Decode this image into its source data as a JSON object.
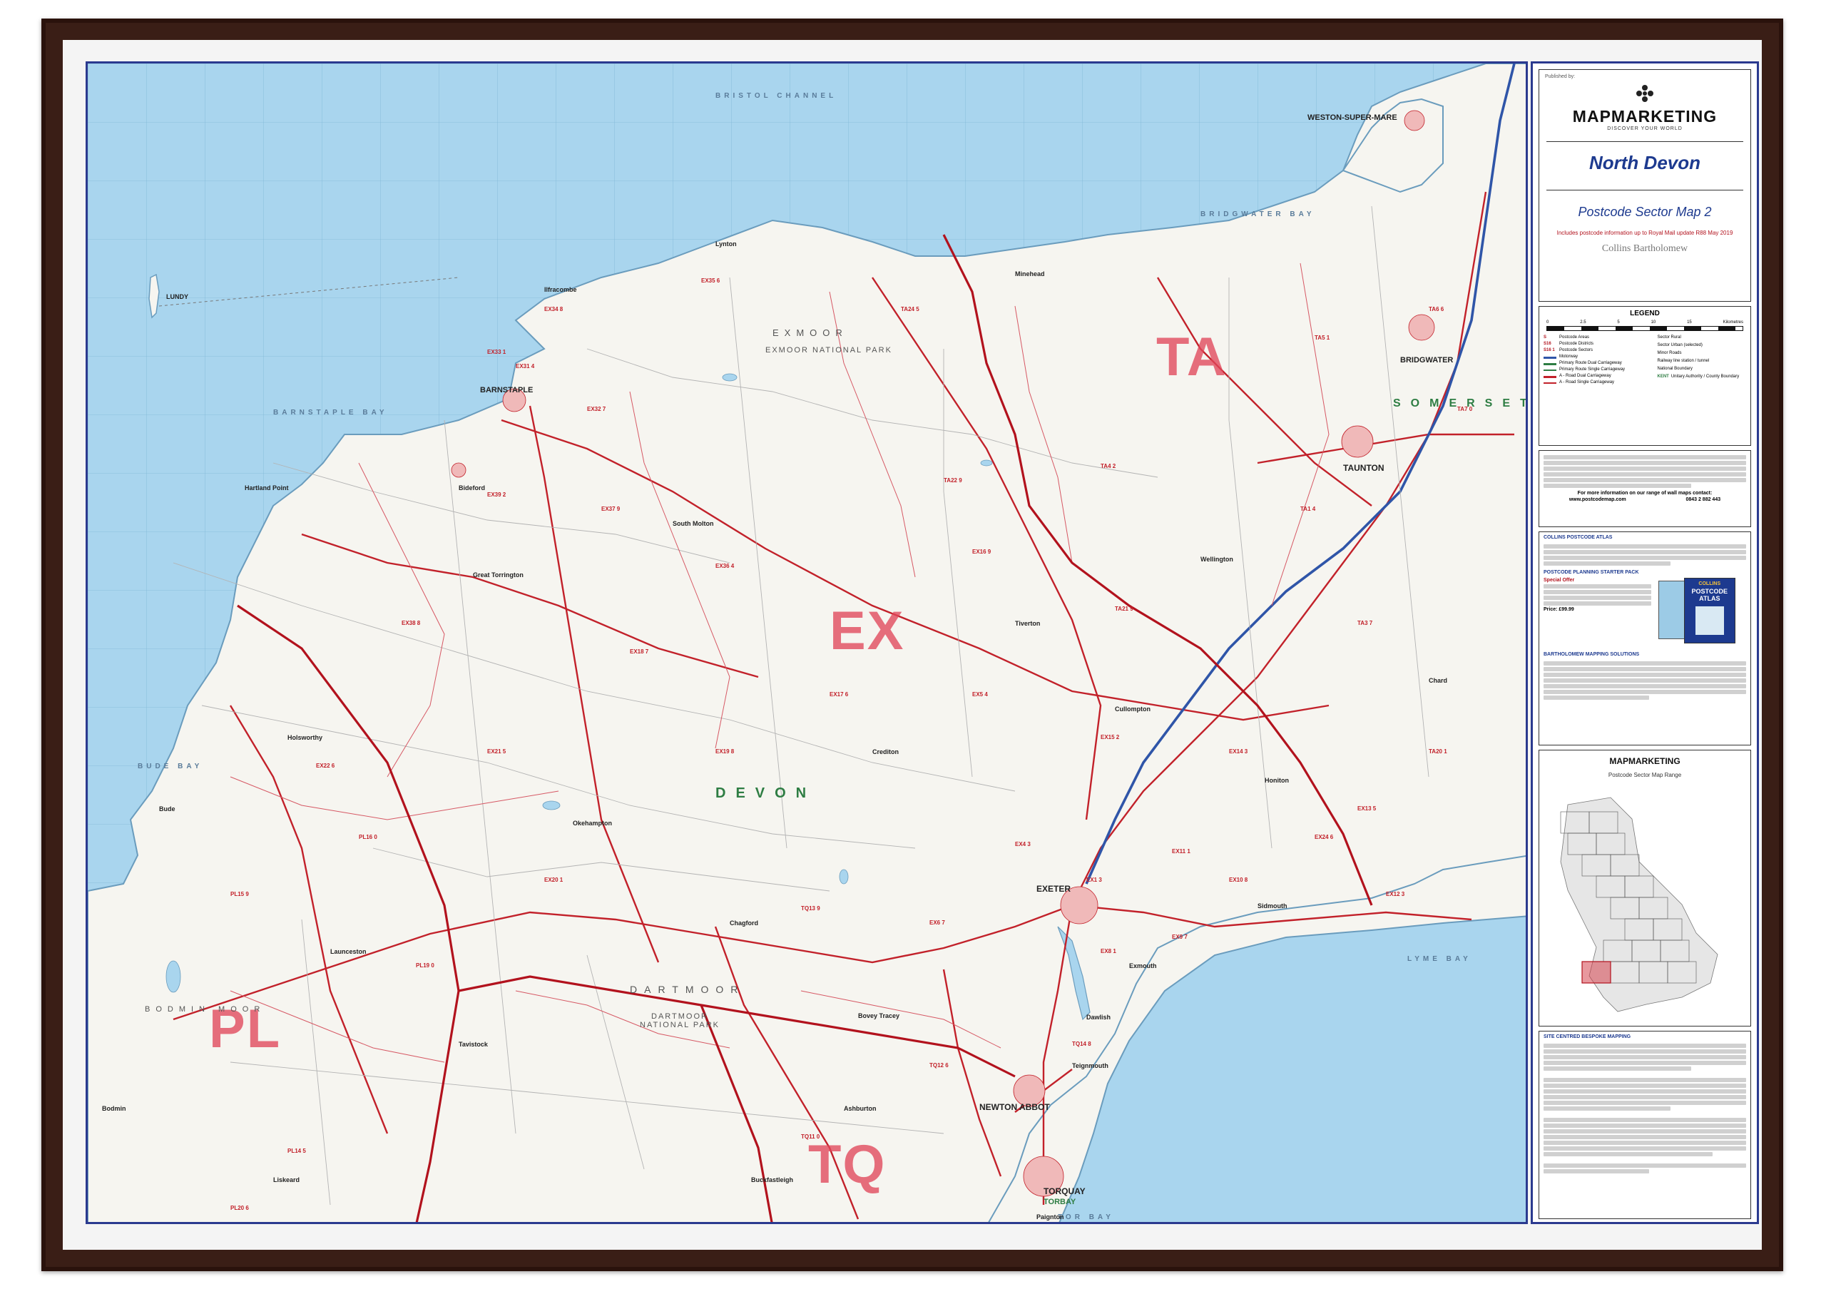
{
  "publisher": {
    "published_by": "Published by:",
    "brand": "MAPMARKETING",
    "tagline": "DISCOVER YOUR WORLD"
  },
  "title": {
    "region": "North Devon",
    "map_name": "Postcode Sector Map 2",
    "update_note": "Includes postcode information up to Royal Mail update R88 May 2019",
    "partner": "Collins Bartholomew"
  },
  "legend": {
    "heading": "LEGEND",
    "scale_ticks": [
      "0",
      "2.5",
      "5",
      "10",
      "15"
    ],
    "scale_units": "Kilometres",
    "items_left": [
      {
        "code": "S",
        "text": "Postcode Areas"
      },
      {
        "code": "S16",
        "text": "Postcode Districts"
      },
      {
        "code": "S16 1",
        "text": "Postcode Sectors"
      },
      {
        "code": "",
        "text": "Motorway"
      },
      {
        "code": "",
        "text": "Primary Route Dual Carriageway"
      },
      {
        "code": "",
        "text": "Primary Route Single Carriageway"
      },
      {
        "code": "",
        "text": "A - Road Dual Carriageway"
      },
      {
        "code": "",
        "text": "A - Road Single Carriageway"
      }
    ],
    "items_right": [
      {
        "code": "",
        "text": "Sector Rural"
      },
      {
        "code": "",
        "text": "Sector Urban (selected)"
      },
      {
        "code": "",
        "text": "Minor Roads"
      },
      {
        "code": "",
        "text": "Railway line station / tunnel"
      },
      {
        "code": "",
        "text": "National Boundary"
      },
      {
        "code": "KENT",
        "text": "Unitary Authority / County Boundary"
      }
    ],
    "contact_line": "For more information on our range of wall maps contact:",
    "website": "www.postcodemap.com",
    "phone": "0843 2 882 443"
  },
  "atlas_panel": {
    "heading": "COLLINS POSTCODE ATLAS",
    "starter_heading": "POSTCODE PLANNING STARTER PACK",
    "special_offer": "Special Offer",
    "price": "Price: £99.99",
    "solutions_heading": "BARTHOLOMEW MAPPING SOLUTIONS",
    "book_title": "POSTCODE ATLAS",
    "book_brand": "COLLINS"
  },
  "range_panel": {
    "brand": "MAPMARKETING",
    "heading": "Postcode Sector Map Range"
  },
  "bespoke_panel": {
    "heading": "SITE CENTRED BESPOKE MAPPING"
  },
  "map": {
    "area_letters": [
      "TA",
      "EX",
      "PL",
      "TQ"
    ],
    "county_devon": "DEVON",
    "county_somerset": "SOMERSET",
    "exmoor": "EXMOOR",
    "exmoor_park": "EXMOOR NATIONAL PARK",
    "dartmoor": "DARTMOOR",
    "dartmoor_park": "DARTMOOR NATIONAL PARK",
    "bodmin": "BODMIN MOOR",
    "sea_bristol": "BRISTOL CHANNEL",
    "sea_bridgwater": "BRIDGWATER BAY",
    "sea_barnstaple": "BARNSTAPLE BAY",
    "sea_lyme": "LYME BAY",
    "sea_bude": "BUDE BAY",
    "sea_tor": "TOR BAY",
    "lundy": "LUNDY",
    "towns": {
      "weston": "WESTON-SUPER-MARE",
      "barnstaple": "BARNSTAPLE",
      "bideford": "Bideford",
      "exeter": "EXETER",
      "taunton": "TAUNTON",
      "bridgwater": "BRIDGWATER",
      "newton_abbot": "NEWTON ABBOT",
      "torquay": "TORQUAY",
      "torbay": "TORBAY",
      "okehampton": "Okehampton",
      "tavistock": "Tavistock",
      "tiverton": "Tiverton",
      "launceston": "Launceston",
      "minehead": "Minehead",
      "ilfracombe": "Ilfracombe",
      "lynton": "Lynton",
      "south_molton": "South Molton",
      "great_torrington": "Great Torrington",
      "holsworthy": "Holsworthy",
      "crediton": "Crediton",
      "cullompton": "Cullompton",
      "honiton": "Honiton",
      "sidmouth": "Sidmouth",
      "exmouth": "Exmouth",
      "dawlish": "Dawlish",
      "teignmouth": "Teignmouth",
      "buckfastleigh": "Buckfastleigh",
      "wellington": "Wellington",
      "chard": "Chard",
      "liskeard": "Liskeard",
      "bodmin_town": "Bodmin",
      "bude": "Bude",
      "hartland": "Hartland Point",
      "chagford": "Chagford",
      "bovey": "Bovey Tracey",
      "ashburton": "Ashburton",
      "paignton": "Paignton"
    },
    "sectors": [
      "EX39 2",
      "EX31 4",
      "EX34 8",
      "EX33 1",
      "EX32 7",
      "EX36 4",
      "EX16 9",
      "EX15 2",
      "EX20 1",
      "EX22 6",
      "EX21 5",
      "EX17 6",
      "EX5 4",
      "EX14 3",
      "EX4 3",
      "EX6 7",
      "TA24 5",
      "TA22 9",
      "TA4 2",
      "TA21 9",
      "TA1 4",
      "TA5 1",
      "TA6 6",
      "TA20 1",
      "TQ13 9",
      "TQ12 6",
      "TQ11 0",
      "TQ14 8",
      "PL15 9",
      "PL19 0",
      "PL14 5",
      "PL20 6",
      "PL16 0",
      "EX10 8",
      "EX24 6",
      "EX11 1",
      "EX1 3",
      "EX9 7",
      "EX8 1",
      "EX12 3",
      "TA3 7",
      "TA7 0",
      "EX35 6",
      "EX13 5",
      "EX37 9",
      "EX18 7",
      "EX19 8",
      "EX38 8"
    ]
  }
}
